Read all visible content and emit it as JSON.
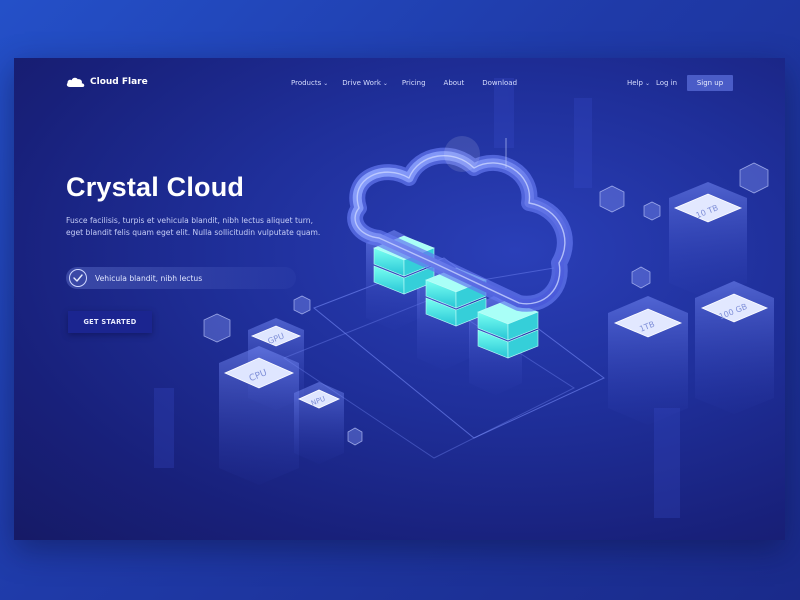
{
  "brand": {
    "name": "Cloud Flare",
    "logo_icon": "cloud-icon"
  },
  "nav": {
    "items": [
      {
        "label": "Products",
        "has_dropdown": true
      },
      {
        "label": "Drive Work",
        "has_dropdown": true
      },
      {
        "label": "Pricing",
        "has_dropdown": false
      },
      {
        "label": "About",
        "has_dropdown": false
      },
      {
        "label": "Download",
        "has_dropdown": false
      }
    ],
    "help_label": "Help",
    "login_label": "Log in",
    "signup_label": "Sign up"
  },
  "hero": {
    "title": "Crystal Cloud",
    "description": "Fusce facilisis, turpis et vehicula blandit, nibh lectus aliquet turn, eget blandit felis quam eget elit. Nulla sollicitudin vulputate quam.",
    "feature": "Vehicula blandit, nibh lectus",
    "cta_label": "GET STARTED"
  },
  "illustration": {
    "chips": [
      "GPU",
      "CPU",
      "NPU"
    ],
    "storage": [
      "10 TB",
      "1TB",
      "100 GB"
    ]
  },
  "colors": {
    "background": "#2048c0",
    "card": "#1f2f9a",
    "accent_cyan": "#49f0e6",
    "button": "#1b2590",
    "signup": "#4a5cc7"
  }
}
